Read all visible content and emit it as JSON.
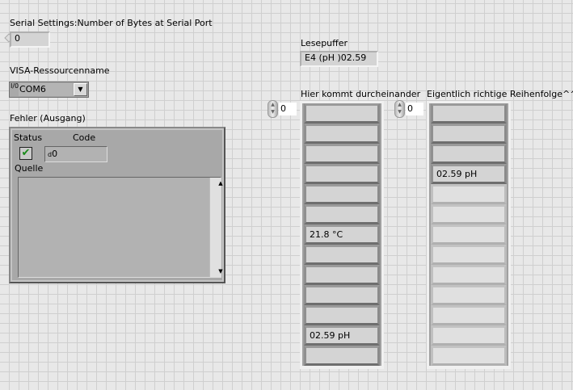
{
  "bytes": {
    "label": "Serial Settings:Number of Bytes at Serial Port",
    "value": "0"
  },
  "visa": {
    "label": "VISA-Ressourcenname",
    "io_glyph": "I/0",
    "value": "COM6",
    "dropdown_icon": "chevron-down-icon"
  },
  "error": {
    "label": "Fehler (Ausgang)",
    "status_label": "Status",
    "code_label": "Code",
    "status_icon": "checkmark-icon",
    "code_prefix": "d",
    "code_value": "0",
    "source_label": "Quelle",
    "source_value": ""
  },
  "buffer": {
    "label": "Lesepuffer",
    "value": "E4 (pH )02.59"
  },
  "array_left": {
    "label": "Hier kommt durcheinander",
    "index": "0",
    "items": [
      "",
      "",
      "",
      "",
      "",
      "",
      "21.8  °C",
      "",
      "",
      "",
      "",
      "02.59  pH",
      ""
    ]
  },
  "array_right": {
    "label": "Eigentlich richtige Reihenfolge^^",
    "index": "0",
    "items": [
      "",
      "",
      "",
      "02.59  pH",
      "",
      "",
      "",
      "",
      "",
      "",
      "",
      "",
      ""
    ],
    "active_count": 4
  }
}
